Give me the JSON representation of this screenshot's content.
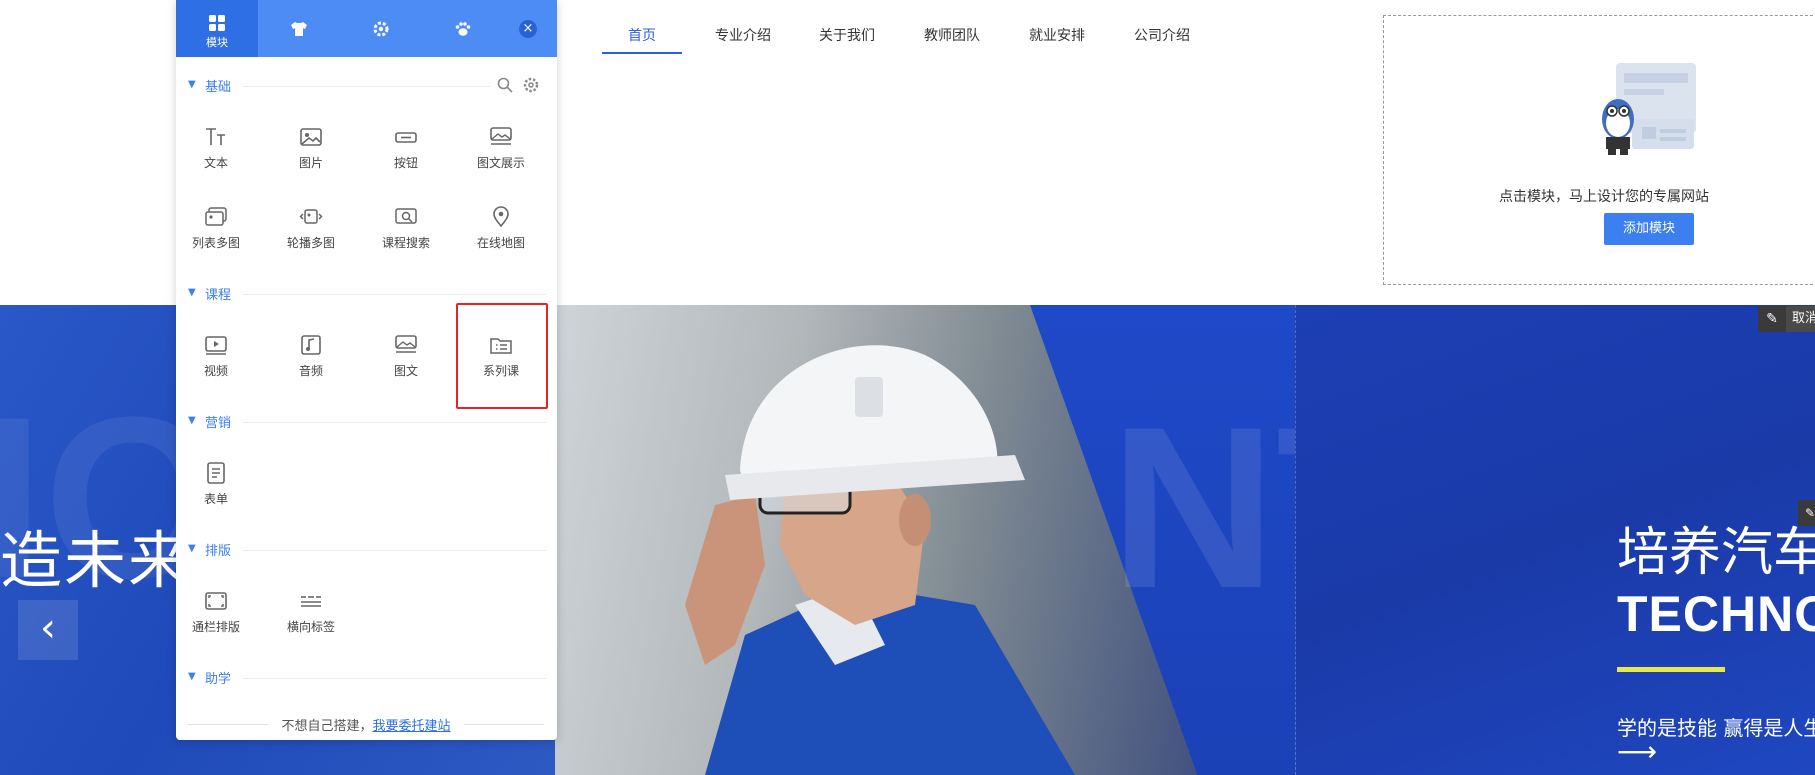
{
  "nav": {
    "items": [
      {
        "label": "首页",
        "active": true
      },
      {
        "label": "专业介绍",
        "active": false
      },
      {
        "label": "关于我们",
        "active": false
      },
      {
        "label": "教师团队",
        "active": false
      },
      {
        "label": "就业安排",
        "active": false
      },
      {
        "label": "公司介绍",
        "active": false
      }
    ]
  },
  "empty_box": {
    "illustration": "robot-mascot-illustration",
    "text": "点击模块，马上设计您的专属网站",
    "button": "添加模块"
  },
  "banner": {
    "left_title": "造未来",
    "left_ghost": "IO",
    "right_ghost": "NT",
    "right_title": "培养汽车",
    "right_subtitle": "TECHNO",
    "right_desc": "学的是技能 赢得是人生",
    "right_arrow": "⟶",
    "prev_icon": "‹",
    "edit_cancel": "取消",
    "accent_color": "#e8e84a"
  },
  "panel": {
    "tabs": [
      {
        "label": "模块",
        "icon": "grid-icon",
        "active": true
      },
      {
        "label": "",
        "icon": "shirt-icon",
        "active": false
      },
      {
        "label": "",
        "icon": "gear-icon",
        "active": false
      },
      {
        "label": "",
        "icon": "paw-icon",
        "active": false
      }
    ],
    "close": "×",
    "sections": [
      {
        "title": "基础",
        "modules": [
          {
            "label": "文本",
            "icon": "text-icon"
          },
          {
            "label": "图片",
            "icon": "image-icon"
          },
          {
            "label": "按钮",
            "icon": "button-icon"
          },
          {
            "label": "图文展示",
            "icon": "image-text-icon"
          },
          {
            "label": "列表多图",
            "icon": "multi-image-list-icon"
          },
          {
            "label": "轮播多图",
            "icon": "carousel-icon"
          },
          {
            "label": "课程搜索",
            "icon": "course-search-icon"
          },
          {
            "label": "在线地图",
            "icon": "map-pin-icon"
          }
        ]
      },
      {
        "title": "课程",
        "modules": [
          {
            "label": "视频",
            "icon": "video-icon"
          },
          {
            "label": "音频",
            "icon": "audio-icon"
          },
          {
            "label": "图文",
            "icon": "image-text-icon"
          },
          {
            "label": "系列课",
            "icon": "series-course-icon"
          }
        ]
      },
      {
        "title": "营销",
        "modules": [
          {
            "label": "表单",
            "icon": "form-icon"
          }
        ]
      },
      {
        "title": "排版",
        "modules": [
          {
            "label": "通栏排版",
            "icon": "full-width-icon"
          },
          {
            "label": "横向标签",
            "icon": "horizontal-tabs-icon"
          }
        ]
      },
      {
        "title": "助学",
        "modules": []
      }
    ],
    "footer_text": "不想自己搭建，",
    "footer_link": "我要委托建站",
    "accent": "#3b7ff0"
  }
}
